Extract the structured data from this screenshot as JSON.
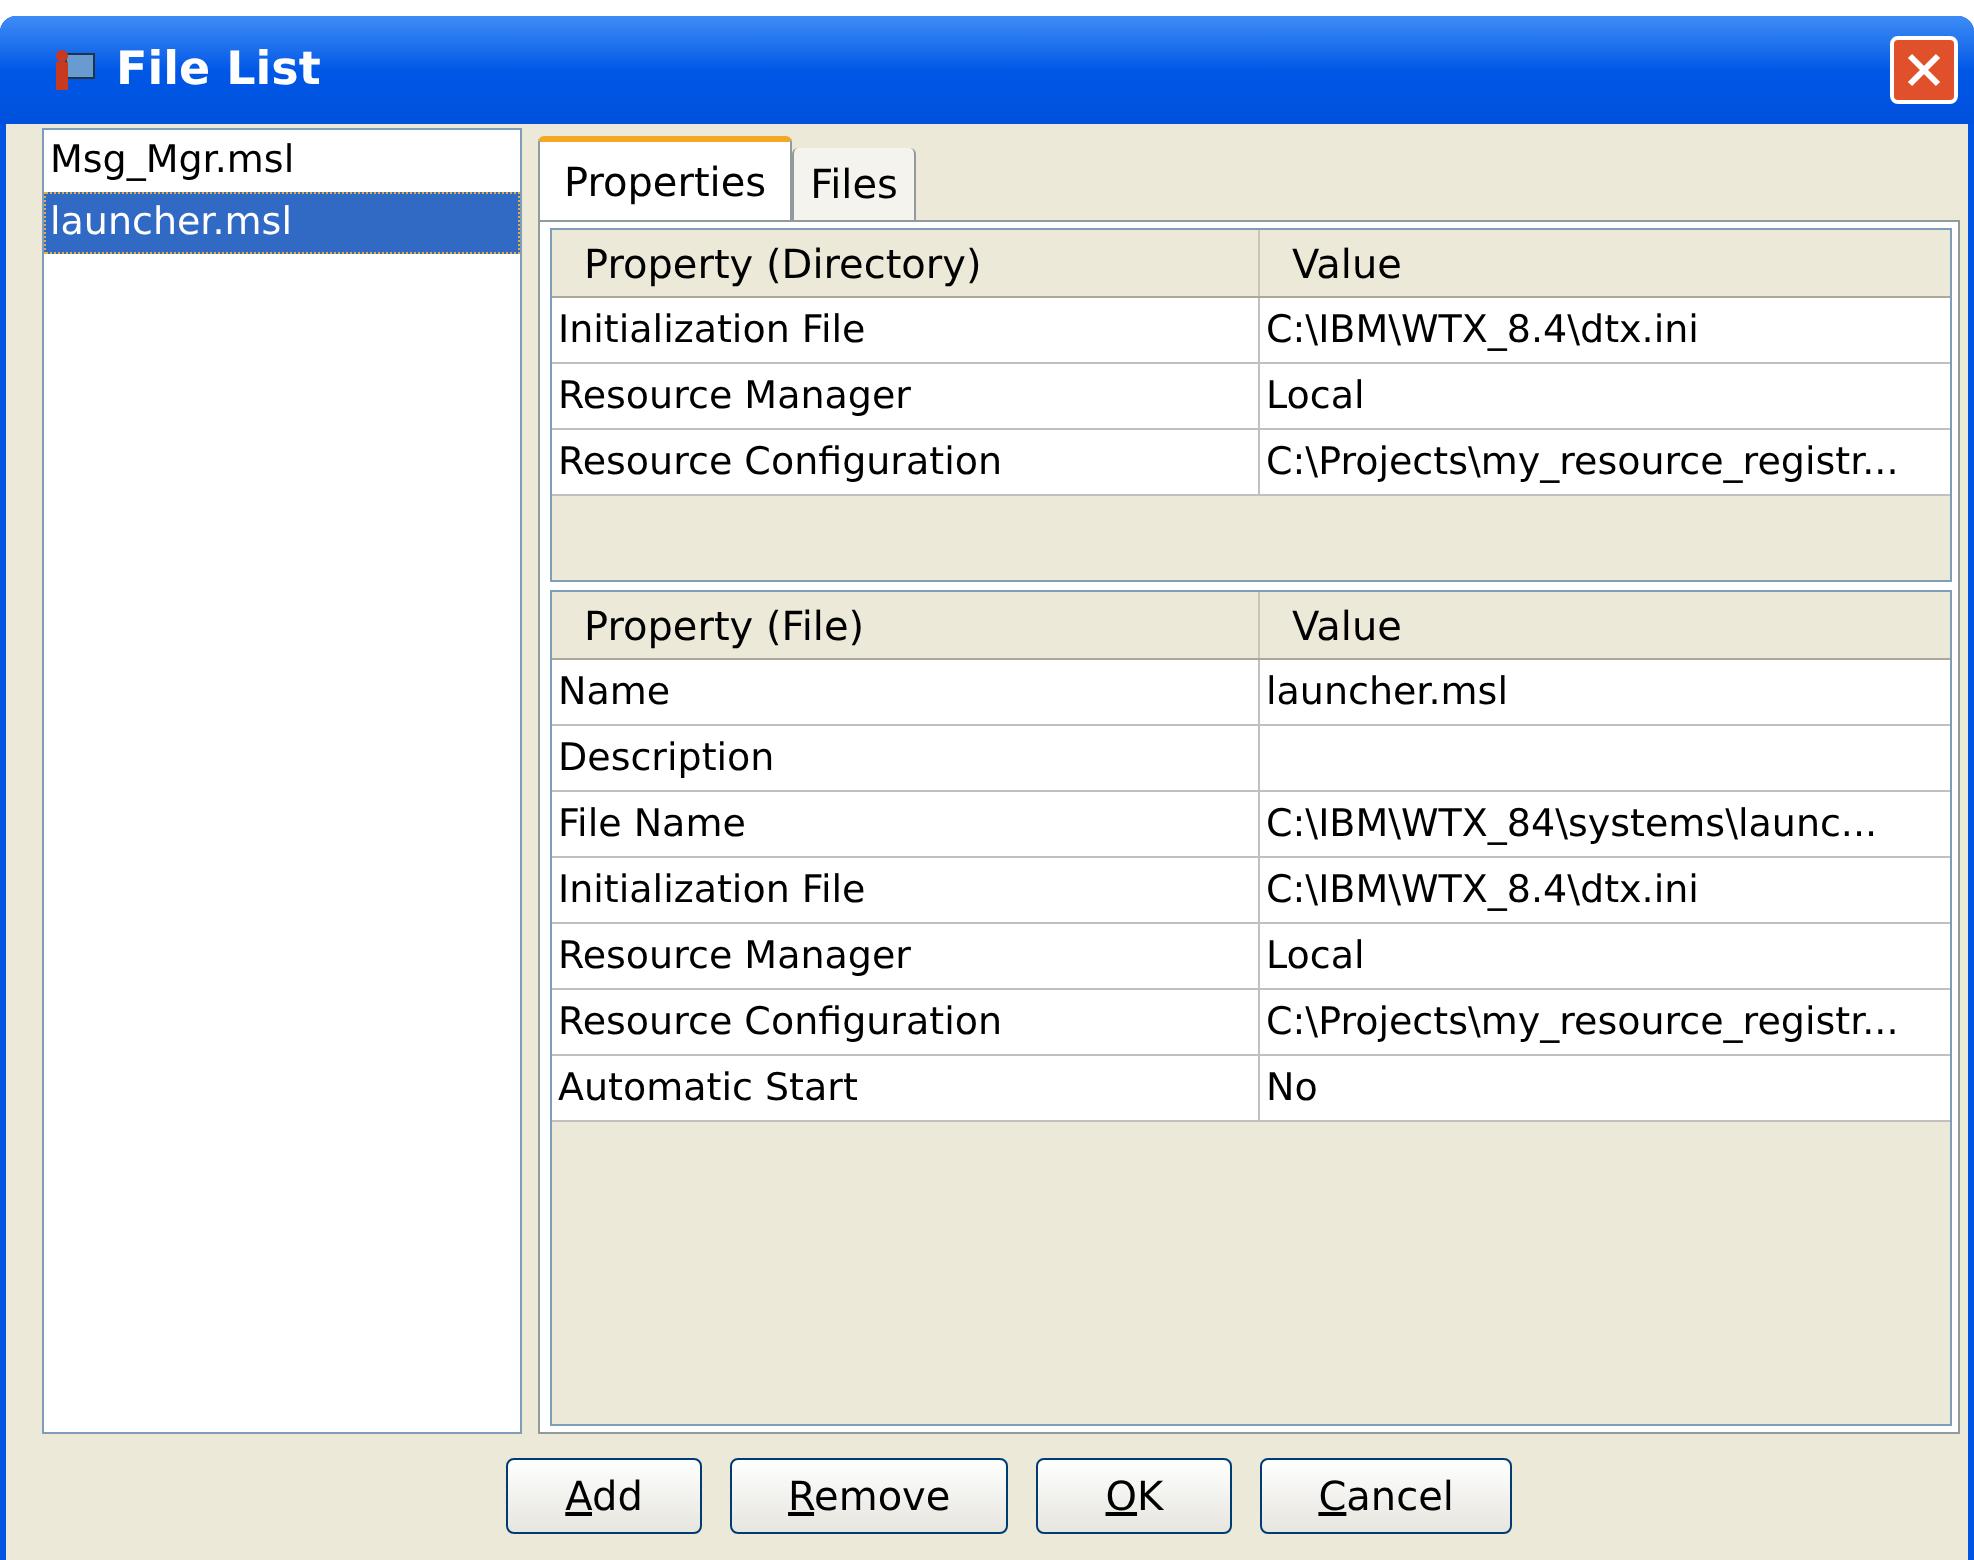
{
  "window": {
    "title": "File List"
  },
  "files": [
    {
      "name": "Msg_Mgr.msl",
      "selected": false
    },
    {
      "name": "launcher.msl",
      "selected": true
    }
  ],
  "tabs": [
    {
      "label": "Properties",
      "selected": true
    },
    {
      "label": "Files",
      "selected": false
    }
  ],
  "directory_table": {
    "columns": [
      "Property (Directory)",
      "Value"
    ],
    "rows": [
      [
        "Initialization File",
        "C:\\IBM\\WTX_8.4\\dtx.ini"
      ],
      [
        "Resource Manager",
        "Local"
      ],
      [
        "Resource Configuration",
        "C:\\Projects\\my_resource_registr..."
      ]
    ]
  },
  "file_table": {
    "columns": [
      "Property (File)",
      "Value"
    ],
    "rows": [
      [
        "Name",
        "launcher.msl"
      ],
      [
        "Description",
        ""
      ],
      [
        "File Name",
        "C:\\IBM\\WTX_84\\systems\\launc..."
      ],
      [
        "Initialization File",
        "C:\\IBM\\WTX_8.4\\dtx.ini"
      ],
      [
        "Resource Manager",
        "Local"
      ],
      [
        "Resource Configuration",
        "C:\\Projects\\my_resource_registr..."
      ],
      [
        "Automatic Start",
        "No"
      ]
    ]
  },
  "buttons": [
    "Add",
    "Remove",
    "OK",
    "Cancel"
  ]
}
